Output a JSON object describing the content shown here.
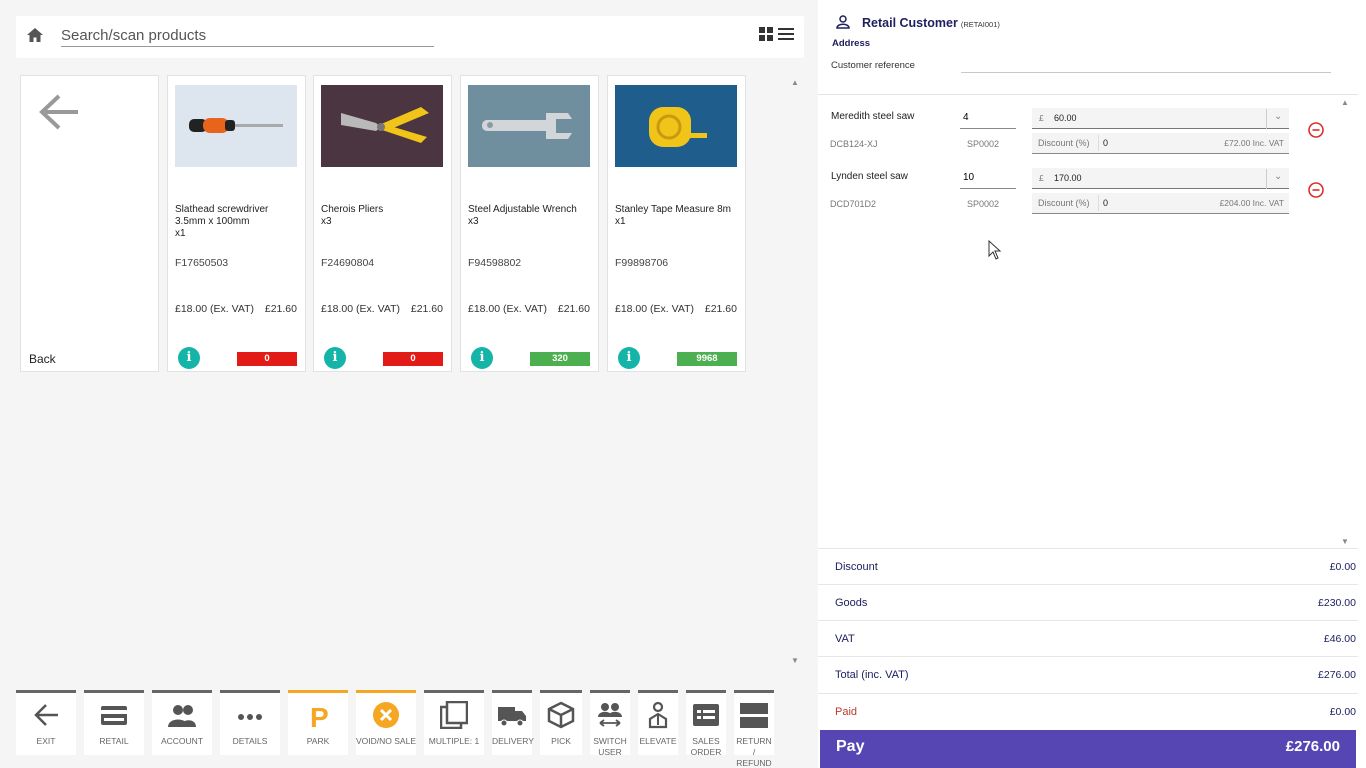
{
  "search": {
    "placeholder": "Search/scan products"
  },
  "products": {
    "back_label": "Back",
    "items": [
      {
        "name": "Slathead screwdriver 3.5mm x 100mm",
        "qty": "x1",
        "code": "F17650503",
        "price_ex": "£18.00 (Ex. VAT)",
        "price_inc": "£21.60",
        "stock": "0",
        "stock_color": "#e31b16",
        "image": "screwdriver"
      },
      {
        "name": "Cherois Pliers",
        "qty": "x3",
        "code": "F24690804",
        "price_ex": "£18.00 (Ex. VAT)",
        "price_inc": "£21.60",
        "stock": "0",
        "stock_color": "#e31b16",
        "image": "pliers"
      },
      {
        "name": "Steel Adjustable Wrench",
        "qty": "x3",
        "code": "F94598802",
        "price_ex": "£18.00 (Ex. VAT)",
        "price_inc": "£21.60",
        "stock": "320",
        "stock_color": "#4caf50",
        "image": "wrench"
      },
      {
        "name": "Stanley Tape Measure 8m",
        "qty": "x1",
        "code": "F99898706",
        "price_ex": "£18.00 (Ex. VAT)",
        "price_inc": "£21.60",
        "stock": "9968",
        "stock_color": "#4caf50",
        "image": "tape-measure"
      }
    ]
  },
  "toolbar": [
    {
      "label": "EXIT",
      "icon": "arrow-left-icon"
    },
    {
      "label": "RETAIL",
      "icon": "card-icon"
    },
    {
      "label": "ACCOUNT",
      "icon": "users-icon"
    },
    {
      "label": "DETAILS",
      "icon": "more-icon"
    },
    {
      "label": "PARK",
      "icon": "park-icon"
    },
    {
      "label": "VOID/NO SALE",
      "icon": "void-icon"
    },
    {
      "label": "MULTIPLE: 1",
      "icon": "copy-icon"
    },
    {
      "label": "DELIVERY",
      "icon": "truck-icon"
    },
    {
      "label": "PICK",
      "icon": "box-icon"
    },
    {
      "label": "SWITCH USER",
      "icon": "switch-user-icon"
    },
    {
      "label": "ELEVATE",
      "icon": "elevate-icon"
    },
    {
      "label": "SALES ORDER",
      "icon": "sales-order-icon"
    },
    {
      "label": "RETURN / REFUND",
      "icon": "return-icon"
    }
  ],
  "customer": {
    "name": "Retail Customer",
    "code": "(RETAI001)",
    "address_label": "Address",
    "reference_label": "Customer reference",
    "reference_value": ""
  },
  "basket": [
    {
      "name": "Meredith steel saw",
      "code": "DCB124-XJ",
      "qty": "4",
      "sp": "SP0002",
      "currency": "£",
      "price": "60.00",
      "discount_label": "Discount (%)",
      "discount": "0",
      "inc_vat": "£72.00 Inc. VAT"
    },
    {
      "name": "Lynden steel saw",
      "code": "DCD701D2",
      "qty": "10",
      "sp": "SP0002",
      "currency": "£",
      "price": "170.00",
      "discount_label": "Discount (%)",
      "discount": "0",
      "inc_vat": "£204.00 Inc. VAT"
    }
  ],
  "totals": [
    {
      "label": "Discount",
      "value": "£0.00"
    },
    {
      "label": "Goods",
      "value": "£230.00"
    },
    {
      "label": "VAT",
      "value": "£46.00"
    },
    {
      "label": "Total (inc. VAT)",
      "value": "£276.00"
    },
    {
      "label": "Paid",
      "value": "£0.00"
    }
  ],
  "pay": {
    "label": "Pay",
    "amount": "£276.00"
  },
  "colors": {
    "accent": "#5546b4",
    "navy": "#1e2160",
    "teal": "#14b5a8",
    "orange": "#f5a623"
  }
}
